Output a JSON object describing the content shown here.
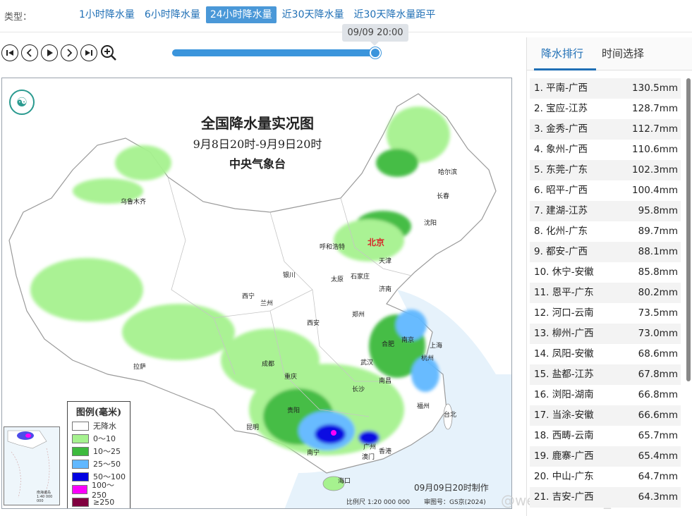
{
  "header": {
    "type_label": "类型：",
    "tabs": [
      {
        "label": "1小时降水量"
      },
      {
        "label": "6小时降水量"
      },
      {
        "label": "24小时降水量"
      },
      {
        "label": "近30天降水量"
      },
      {
        "label": "近30天降水量距平"
      }
    ],
    "active_tab": 2
  },
  "player": {
    "time_label": "09/09 20:00",
    "progress": 1.0
  },
  "map": {
    "title": "全国降水量实况图",
    "subtitle": "9月8日20时-9月9日20时",
    "org": "中央气象台",
    "cities": [
      {
        "name": "哈尔滨"
      },
      {
        "name": "长春"
      },
      {
        "name": "乌鲁木齐"
      },
      {
        "name": "沈阳"
      },
      {
        "name": "呼和浩特"
      },
      {
        "name": "北京"
      },
      {
        "name": "天津"
      },
      {
        "name": "银川"
      },
      {
        "name": "太原"
      },
      {
        "name": "石家庄"
      },
      {
        "name": "济南"
      },
      {
        "name": "西宁"
      },
      {
        "name": "兰州"
      },
      {
        "name": "郑州"
      },
      {
        "name": "西安"
      },
      {
        "name": "合肥"
      },
      {
        "name": "南京"
      },
      {
        "name": "上海"
      },
      {
        "name": "拉萨"
      },
      {
        "name": "成都"
      },
      {
        "name": "武汉"
      },
      {
        "name": "杭州"
      },
      {
        "name": "重庆"
      },
      {
        "name": "长沙"
      },
      {
        "name": "南昌"
      },
      {
        "name": "贵阳"
      },
      {
        "name": "福州"
      },
      {
        "name": "昆明"
      },
      {
        "name": "台北"
      },
      {
        "name": "南宁"
      },
      {
        "name": "广州"
      },
      {
        "name": "澳门"
      },
      {
        "name": "香港"
      },
      {
        "name": "海口"
      }
    ],
    "legend": {
      "title": "图例(毫米)",
      "items": [
        {
          "label": "无降水",
          "color": "#ffffff"
        },
        {
          "label": "0～10",
          "color": "#a6f28f"
        },
        {
          "label": "10～25",
          "color": "#3dba3d"
        },
        {
          "label": "25～50",
          "color": "#61b8ff"
        },
        {
          "label": "50～100",
          "color": "#0000e1"
        },
        {
          "label": "100～250",
          "color": "#fa00fa"
        },
        {
          "label": "≥250",
          "color": "#800040"
        }
      ]
    },
    "inset_label": "南海诸岛\n1:40 000 000",
    "made_text": "09月09日20时制作",
    "scale_text": "比例尺 1:20 000 000",
    "review_text": "审图号：GS京(2024)",
    "watermark": "@weatherman_信欣"
  },
  "panel": {
    "tabs": [
      {
        "label": "降水排行"
      },
      {
        "label": "时间选择"
      }
    ],
    "ranking": [
      {
        "name": "1. 平南-广西",
        "value": "130.5mm"
      },
      {
        "name": "2. 宝应-江苏",
        "value": "128.7mm"
      },
      {
        "name": "3. 金秀-广西",
        "value": "112.7mm"
      },
      {
        "name": "4. 象州-广西",
        "value": "110.6mm"
      },
      {
        "name": "5. 东莞-广东",
        "value": "102.3mm"
      },
      {
        "name": "6. 昭平-广西",
        "value": "100.4mm"
      },
      {
        "name": "7. 建湖-江苏",
        "value": "95.8mm"
      },
      {
        "name": "8. 化州-广东",
        "value": "89.7mm"
      },
      {
        "name": "9. 都安-广西",
        "value": "88.1mm"
      },
      {
        "name": "10. 休宁-安徽",
        "value": "85.8mm"
      },
      {
        "name": "11. 恩平-广东",
        "value": "80.2mm"
      },
      {
        "name": "12. 河口-云南",
        "value": "73.5mm"
      },
      {
        "name": "13. 柳州-广西",
        "value": "73.0mm"
      },
      {
        "name": "14. 凤阳-安徽",
        "value": "68.6mm"
      },
      {
        "name": "15. 盐都-江苏",
        "value": "67.8mm"
      },
      {
        "name": "16. 浏阳-湖南",
        "value": "66.8mm"
      },
      {
        "name": "17. 当涂-安徽",
        "value": "66.6mm"
      },
      {
        "name": "18. 西畴-云南",
        "value": "65.7mm"
      },
      {
        "name": "19. 鹿寨-广西",
        "value": "65.4mm"
      },
      {
        "name": "20. 中山-广东",
        "value": "64.7mm"
      },
      {
        "name": "21. 吉安-广西",
        "value": "64.3mm"
      }
    ]
  }
}
